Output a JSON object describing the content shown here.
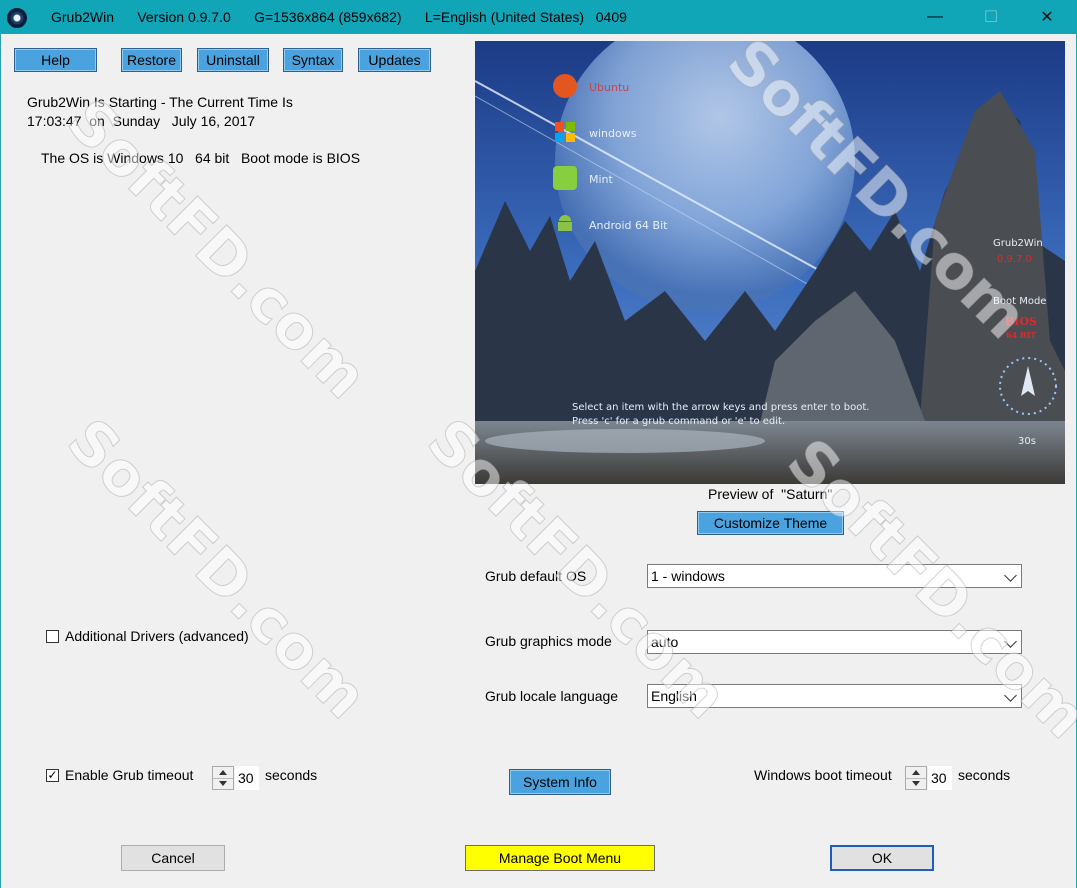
{
  "window": {
    "app_name": "Grub2Win",
    "title_text": "Grub2Win      Version 0.9.7.0      G=1536x864 (859x682)      L=English (United States)   0409",
    "minimize": "—",
    "maximize": "☐",
    "close": "✕",
    "titlebar_color": "#11a5b8"
  },
  "toolbar": {
    "help": "Help",
    "restore": "Restore",
    "uninstall": "Uninstall",
    "syntax": "Syntax",
    "updates": "Updates"
  },
  "status": {
    "line1": "Grub2Win Is Starting - The Current Time Is",
    "line2": "17:03:47  on  Sunday   July 16, 2017",
    "os_info": "The OS is Windows 10   64 bit   Boot mode is BIOS"
  },
  "preview": {
    "menu_items": [
      "Ubuntu",
      "windows",
      "Mint",
      "Android 64 Bit"
    ],
    "side_title": "Grub2Win",
    "side_version": "0.9.7.0",
    "boot_mode_label": "Boot Mode",
    "boot_mode_value": "BIOS",
    "bit_value": "64 BIT",
    "countdown": "30s",
    "hint_line1": "Select an item with the arrow keys and press enter to boot.",
    "hint_line2": "Press 'c' for a grub command or 'e' to edit.",
    "caption": "Preview of  \"Saturn\"",
    "customize_button": "Customize Theme"
  },
  "settings": {
    "default_os_label": "Grub default OS",
    "default_os_value": "1  -  windows",
    "graphics_mode_label": "Grub graphics mode",
    "graphics_mode_value": "auto",
    "locale_label": "Grub locale language",
    "locale_value": "English"
  },
  "options": {
    "additional_drivers_label": "Additional Drivers (advanced)",
    "additional_drivers_checked": false,
    "enable_timeout_label": "Enable Grub timeout",
    "enable_timeout_checked": true,
    "grub_timeout_value": "30",
    "grub_timeout_unit": "seconds",
    "system_info_button": "System Info",
    "windows_timeout_label": "Windows boot timeout",
    "windows_timeout_value": "30",
    "windows_timeout_unit": "seconds"
  },
  "footer": {
    "cancel": "Cancel",
    "manage": "Manage Boot Menu",
    "ok": "OK"
  },
  "watermark_text": "SoftFD.com"
}
